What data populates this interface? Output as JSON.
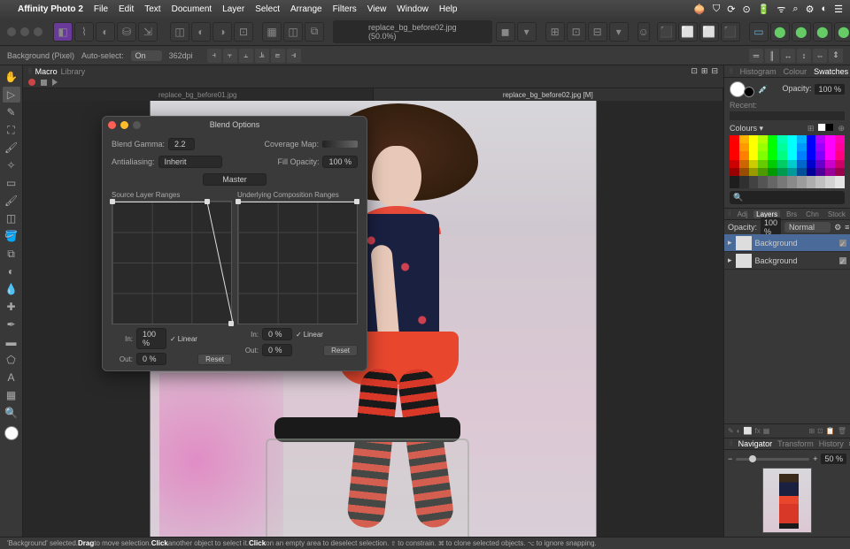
{
  "menubar": {
    "app_icon": "",
    "app_name": "Affinity Photo 2",
    "items": [
      "File",
      "Edit",
      "Text",
      "Document",
      "Layer",
      "Select",
      "Arrange",
      "Filters",
      "View",
      "Window",
      "Help"
    ]
  },
  "toolbar": {
    "doc_title": "replace_bg_before02.jpg (50.0%)"
  },
  "context": {
    "layer_label": "Background (Pixel)",
    "auto_label": "Auto-select:",
    "auto_value": "On",
    "dpi": "362dpi"
  },
  "macro": {
    "tabs": [
      "Macro",
      "Library"
    ],
    "active": 0
  },
  "tabs": [
    {
      "label": "replace_bg_before01.jpg"
    },
    {
      "label": "replace_bg_before02.jpg [M]"
    }
  ],
  "active_tab": 1,
  "swatches": {
    "tabs": [
      "Histogram",
      "Colour",
      "Swatches"
    ],
    "active": 2,
    "opacity_label": "Opacity:",
    "opacity_value": "100 %",
    "recent_label": "Recent:",
    "colours_label": "Colours",
    "search_placeholder": "🔍"
  },
  "layers": {
    "tabs": [
      "Adj",
      "Layers",
      "Brs",
      "Chn",
      "Stock"
    ],
    "active": 1,
    "opacity_label": "Opacity:",
    "opacity_value": "100 %",
    "blend_mode": "Normal",
    "items": [
      {
        "name": "Background",
        "selected": true
      },
      {
        "name": "Background",
        "selected": false
      }
    ],
    "fx_icons": [
      "✎",
      "◐",
      "⬜",
      "fx",
      "▦",
      "⊞",
      "⊡",
      "📋",
      "🗑"
    ]
  },
  "navigator": {
    "tabs": [
      "Navigator",
      "Transform",
      "History"
    ],
    "active": 0,
    "zoom": "50 %"
  },
  "blend_dialog": {
    "title": "Blend Options",
    "gamma_label": "Blend Gamma:",
    "gamma_value": "2.2",
    "coverage_label": "Coverage Map:",
    "antialias_label": "Antialiasing:",
    "antialias_value": "Inherit",
    "fill_label": "Fill Opacity:",
    "fill_value": "100 %",
    "channel_value": "Master",
    "source_label": "Source Layer Ranges",
    "underlying_label": "Underlying Composition Ranges",
    "in_label": "In:",
    "out_label": "Out:",
    "source_in": "100 %",
    "source_out": "0 %",
    "under_in": "0 %",
    "under_out": "0 %",
    "linear_label": "Linear",
    "reset_label": "Reset"
  },
  "status": {
    "prefix": "'Background' selected. ",
    "drag": "Drag",
    "t1": " to move selection. ",
    "click1": "Click",
    "t2": " another object to select it. ",
    "click2": "Click",
    "t3": " on an empty area to deselect selection. ",
    "sym1": "⇧",
    "t4": " to constrain. ",
    "sym2": "⌘",
    "t5": " to clone selected objects. ",
    "sym3": "⌥",
    "t6": " to ignore snapping."
  },
  "colors": {
    "accent": "#6a3a9a"
  }
}
